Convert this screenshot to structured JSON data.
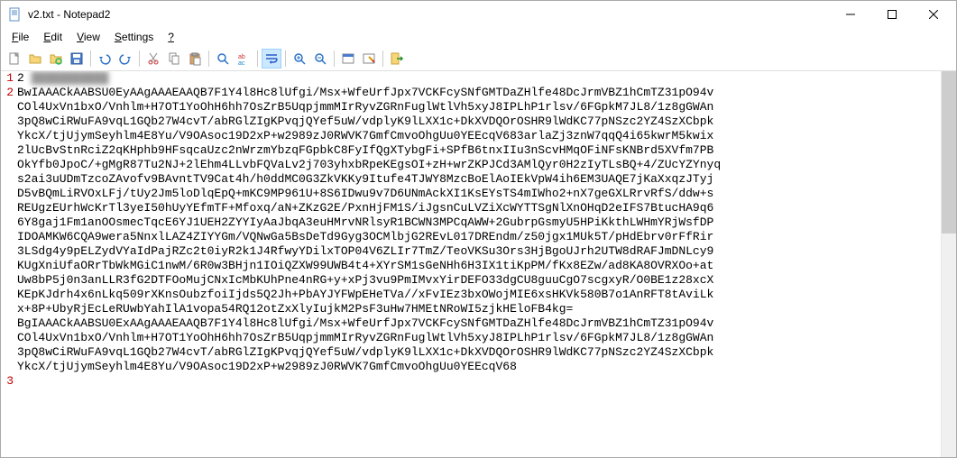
{
  "window": {
    "title": "v2.txt - Notepad2"
  },
  "menu": {
    "file": "File",
    "edit": "Edit",
    "view": "View",
    "settings": "Settings",
    "help": "?"
  },
  "editor": {
    "gutter": [
      "1",
      "2",
      "",
      "",
      "",
      "",
      "",
      "",
      "",
      "",
      "",
      "",
      "",
      "",
      "",
      "",
      "",
      "",
      "",
      "",
      "",
      "3",
      "",
      "",
      ""
    ],
    "lines": [
      "2",
      "BwIAAACkAABSU0EyAAgAAAEAAQB7F1Y4l8Hc8lUfgi/Msx+WfeUrfJpx7VCKFcySNfGMTDaZHlfe48DcJrmVBZ1hCmTZ31pO94v",
      "COl4UxVn1bxO/Vnhlm+H7OT1YoOhH6hh7OsZrB5UqpjmmMIrRyvZGRnFuglWtlVh5xyJ8IPLhP1rlsv/6FGpkM7JL8/1z8gGWAn",
      "3pQ8wCiRWuFA9vqL1GQb27W4cvT/abRGlZIgKPvqjQYef5uW/vdplyK9lLXX1c+DkXVDQOrOSHR9lWdKC77pNSzc2YZ4SzXCbpk",
      "YkcX/tjUjymSeyhlm4E8Yu/V9OAsoc19D2xP+w2989zJ0RWVK7GmfCmvoOhgUu0YEEcqV683arlaZj3znW7qqQ4i65kwrM5kwix",
      "2lUcBvStnRciZ2qKHphb9HFsqcaUzc2nWrzmYbzqFGpbkC8FyIfQgXTybgFi+SPfB6tnxIIu3nScvHMqOFiNFsKNBrd5XVfm7PB",
      "OkYfb0JpoC/+gMgR87Tu2NJ+2lEhm4LLvbFQVaLv2j703yhxbRpeKEgsOI+zH+wrZKPJCd3AMlQyr0H2zIyTLsBQ+4/ZUcYZYnyq",
      "s2ai3uUDmTzcoZAvofv9BAvntTV9Cat4h/h0ddMC0G3ZkVKKy9Itufe4TJWY8MzcBoElAoIEkVpW4ih6EM3UAQE7jKaXxqzJTyj",
      "D5vBQmLiRVOxLFj/tUy2Jm5loDlqEpQ+mKC9MP961U+8S6IDwu9v7D6UNmAckXI1KsEYsTS4mIWho2+nX7geGXLRrvRfS/ddw+s",
      "REUgzEUrhWcKrTl3yeI50hUyYEfmTF+Mfoxq/aN+ZKzG2E/PxnHjFM1S/iJgsnCuLVZiXcWYTTSgNlXnOHqD2eIFS7BtucHA9q6",
      "6Y8gaj1Fm1anOOsmecTqcE6YJ1UEH2ZYYIyAaJbqA3euHMrvNRlsyR1BCWN3MPCqAWW+2GubrpGsmyU5HPiKkthLWHmYRjWsfDP",
      "IDOAMKW6CQA9wera5NnxlLAZ4ZIYYGm/VQNwGa5BsDeTd9Gyg3OCMlbjG2REvL017DREndm/z50jgx1MUk5T/pHdEbrv0rFfRir",
      "3LSdg4y9pELZydVYaIdPajRZc2t0iyR2k1J4RfwyYDilxTOP04V6ZLIr7TmZ/TeoVKSu3Ors3HjBgoUJrh2UTW8dRAFJmDNLcy9",
      "KUgXniUfaORrTbWkMGiC1nwM/6R0w3BHjn1IOiQZXW99UWB4t4+XYrSM1sGeNHh6H3IX1tiKpPM/fKx8EZw/ad8KA8OVRXOo+at",
      "Uw8bP5j0n3anLLR3fG2DTFOoMujCNxIcMbKUhPne4nRG+y+xPj3vu9PmIMvxYirDEFO33dgCU8guuCgO7scgxyR/O0BE1z28xcX",
      "KEpKJdrh4x6nLkq509rXKnsOubzfoiIjds5Q2Jh+PbAYJYFWpEHeTVa//xFvIEz3bxOWojMIE6xsHKVk580B7o1AnRFT8tAviLk",
      "x+8P+UbyRjEcLeRUwbYahIlA1vopa54RQ12otZxXlyIujkM2PsF3uHw7HMEtNRoWI5zjkHEloFB4kg=",
      "BgIAAACkAABSU0ExAAgAAAEAAQB7F1Y4l8Hc8lUfgi/Msx+WfeUrfJpx7VCKFcySNfGMTDaZHlfe48DcJrmVBZ1hCmTZ31pO94v",
      "COl4UxVn1bxO/Vnhlm+H7OT1YoOhH6hh7OsZrB5UqpjmmMIrRyvZGRnFuglWtlVh5xyJ8IPLhP1rlsv/6FGpkM7JL8/1z8gGWAn",
      "3pQ8wCiRWuFA9vqL1GQb27W4cvT/abRGlZIgKPvqjQYef5uW/vdplyK9lLXX1c+DkXVDQOrOSHR9lWdKC77pNSzc2YZ4SzXCbpk",
      "YkcX/tjUjymSeyhlm4E8Yu/V9OAsoc19D2xP+w2989zJ0RWVK7GmfCmvoOhgUu0YEEcqV68"
    ],
    "line1_blurred": "███████████"
  }
}
